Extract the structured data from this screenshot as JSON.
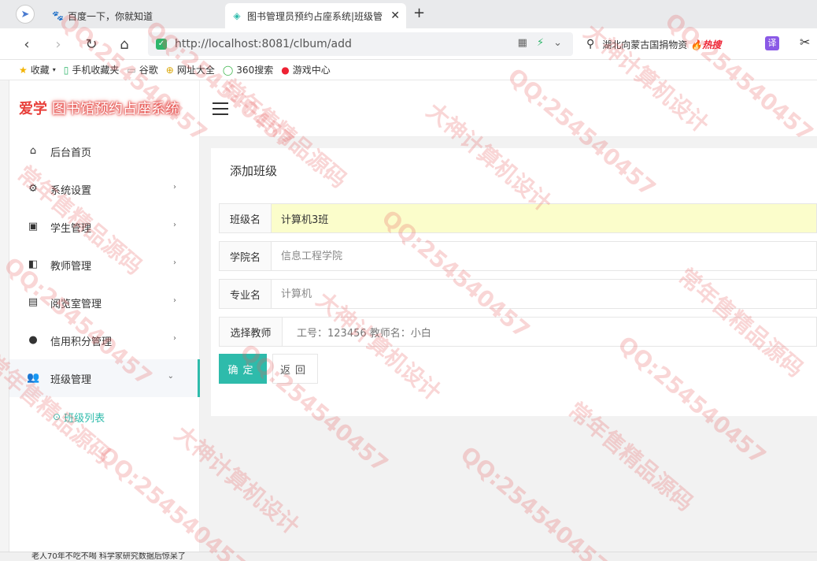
{
  "browser": {
    "tabs": [
      {
        "title": "百度一下，你就知道",
        "icon": "paw-icon"
      },
      {
        "title": "图书管理员预约占座系统|班级管",
        "icon": "diamond-icon"
      }
    ],
    "url": "http://localhost:8081/clbum/add",
    "search_text": "湖北向蒙古国捐物资",
    "search_badge": "热搜",
    "translate_label": "译",
    "bookmarks": [
      "收藏",
      "手机收藏夹",
      "谷歌",
      "网址大全",
      "360搜索",
      "游戏中心"
    ]
  },
  "sidebar": {
    "logo_prefix": "爱学",
    "logo_title": "图书馆预约占座系统",
    "items": [
      {
        "label": "后台首页",
        "icon": "home-icon",
        "arrow": false
      },
      {
        "label": "系统设置",
        "icon": "gear-icon",
        "arrow": true
      },
      {
        "label": "学生管理",
        "icon": "student-badge-icon",
        "arrow": true
      },
      {
        "label": "教师管理",
        "icon": "teacher-board-icon",
        "arrow": true
      },
      {
        "label": "阅览室管理",
        "icon": "book-icon",
        "arrow": true
      },
      {
        "label": "信用积分管理",
        "icon": "person-icon",
        "arrow": true
      },
      {
        "label": "班级管理",
        "icon": "people-icon",
        "arrow": true,
        "expanded": true
      }
    ],
    "sub_item": "班级列表"
  },
  "form": {
    "title": "添加班级",
    "class_name_label": "班级名",
    "class_name_value": "计算机3班",
    "college_label": "学院名",
    "college_placeholder": "信息工程学院",
    "major_label": "专业名",
    "major_placeholder": "计算机",
    "teacher_label": "选择教师",
    "teacher_value": "工号：123456  教师名：小白",
    "ok_label": "确定",
    "back_label": "返回"
  },
  "statusbar": {
    "text": "老人70年不吃不喝 科学家研究数据后惊呆了"
  },
  "watermarks": [
    "QQ:254540457",
    "常年售精品源码",
    "大神计算机设计"
  ]
}
